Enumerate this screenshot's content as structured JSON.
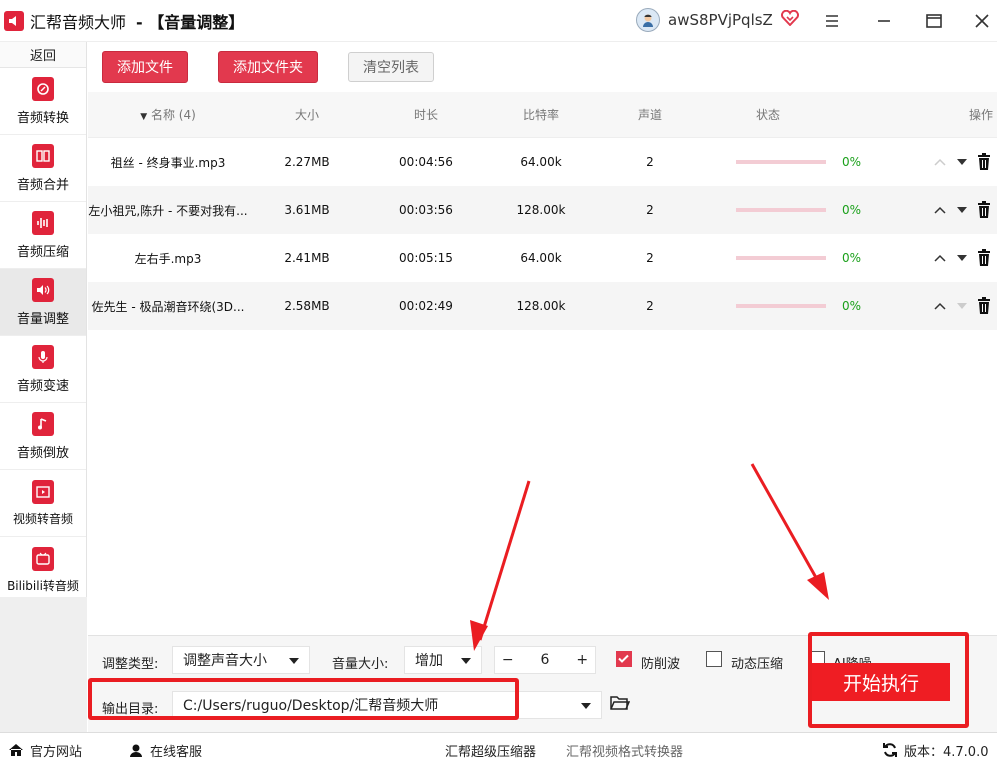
{
  "app": {
    "title": "汇帮音频大师",
    "subtitle": "-  【音量调整】",
    "username": "awS8PVjPqlsZ"
  },
  "sidebar": {
    "back": "返回",
    "items": [
      {
        "label": "音频转换",
        "icon": "audio-convert-icon",
        "active": false
      },
      {
        "label": "音频合并",
        "icon": "audio-merge-icon",
        "active": false
      },
      {
        "label": "音频压缩",
        "icon": "audio-compress-icon",
        "active": false
      },
      {
        "label": "音量调整",
        "icon": "volume-icon",
        "active": true
      },
      {
        "label": "音频变速",
        "icon": "microphone-icon",
        "active": false
      },
      {
        "label": "音频倒放",
        "icon": "music-note-icon",
        "active": false
      },
      {
        "label": "视频转音频",
        "icon": "film-icon",
        "active": false
      },
      {
        "label": "Bilibili转音频",
        "icon": "tv-icon",
        "active": false
      }
    ]
  },
  "toolbar": {
    "add_file": "添加文件",
    "add_folder": "添加文件夹",
    "clear_list": "清空列表"
  },
  "table": {
    "headers": {
      "name": "名称 (4)",
      "size": "大小",
      "duration": "时长",
      "bitrate": "比特率",
      "channels": "声道",
      "status": "状态",
      "actions": "操作"
    },
    "rows": [
      {
        "name": "祖丝 - 终身事业.mp3",
        "size": "2.27MB",
        "duration": "00:04:56",
        "bitrate": "64.00k",
        "channels": "2",
        "progress": "0%"
      },
      {
        "name": "左小祖咒,陈升 - 不要对我有...",
        "size": "3.61MB",
        "duration": "00:03:56",
        "bitrate": "128.00k",
        "channels": "2",
        "progress": "0%"
      },
      {
        "name": "左右手.mp3",
        "size": "2.41MB",
        "duration": "00:05:15",
        "bitrate": "64.00k",
        "channels": "2",
        "progress": "0%"
      },
      {
        "name": "佐先生 - 极品潮音环绕(3D...",
        "size": "2.58MB",
        "duration": "00:02:49",
        "bitrate": "128.00k",
        "channels": "2",
        "progress": "0%"
      }
    ]
  },
  "settings": {
    "adjust_type_label": "调整类型:",
    "adjust_type_value": "调整声音大小",
    "volume_label": "音量大小:",
    "volume_mode": "增加",
    "minus": "−",
    "volume_value": "6",
    "plus": "+",
    "anti_clip_label": "防削波",
    "anti_clip_checked": true,
    "dynamic_compress_label": "动态压缩",
    "dynamic_compress_checked": false,
    "ai_denoise_label": "AI降噪",
    "ai_denoise_checked": false,
    "output_label": "输出目录:",
    "output_path": "C:/Users/ruguo/Desktop/汇帮音频大师",
    "start_button": "开始执行"
  },
  "statusbar": {
    "website": "官方网站",
    "support": "在线客服",
    "link1": "汇帮超级压缩器",
    "link2": "汇帮视频格式转换器",
    "version": "版本：4.7.0.0"
  },
  "colors": {
    "accent": "#e2394e",
    "highlight": "#ea1d22",
    "progress_text": "#1aa01a"
  }
}
